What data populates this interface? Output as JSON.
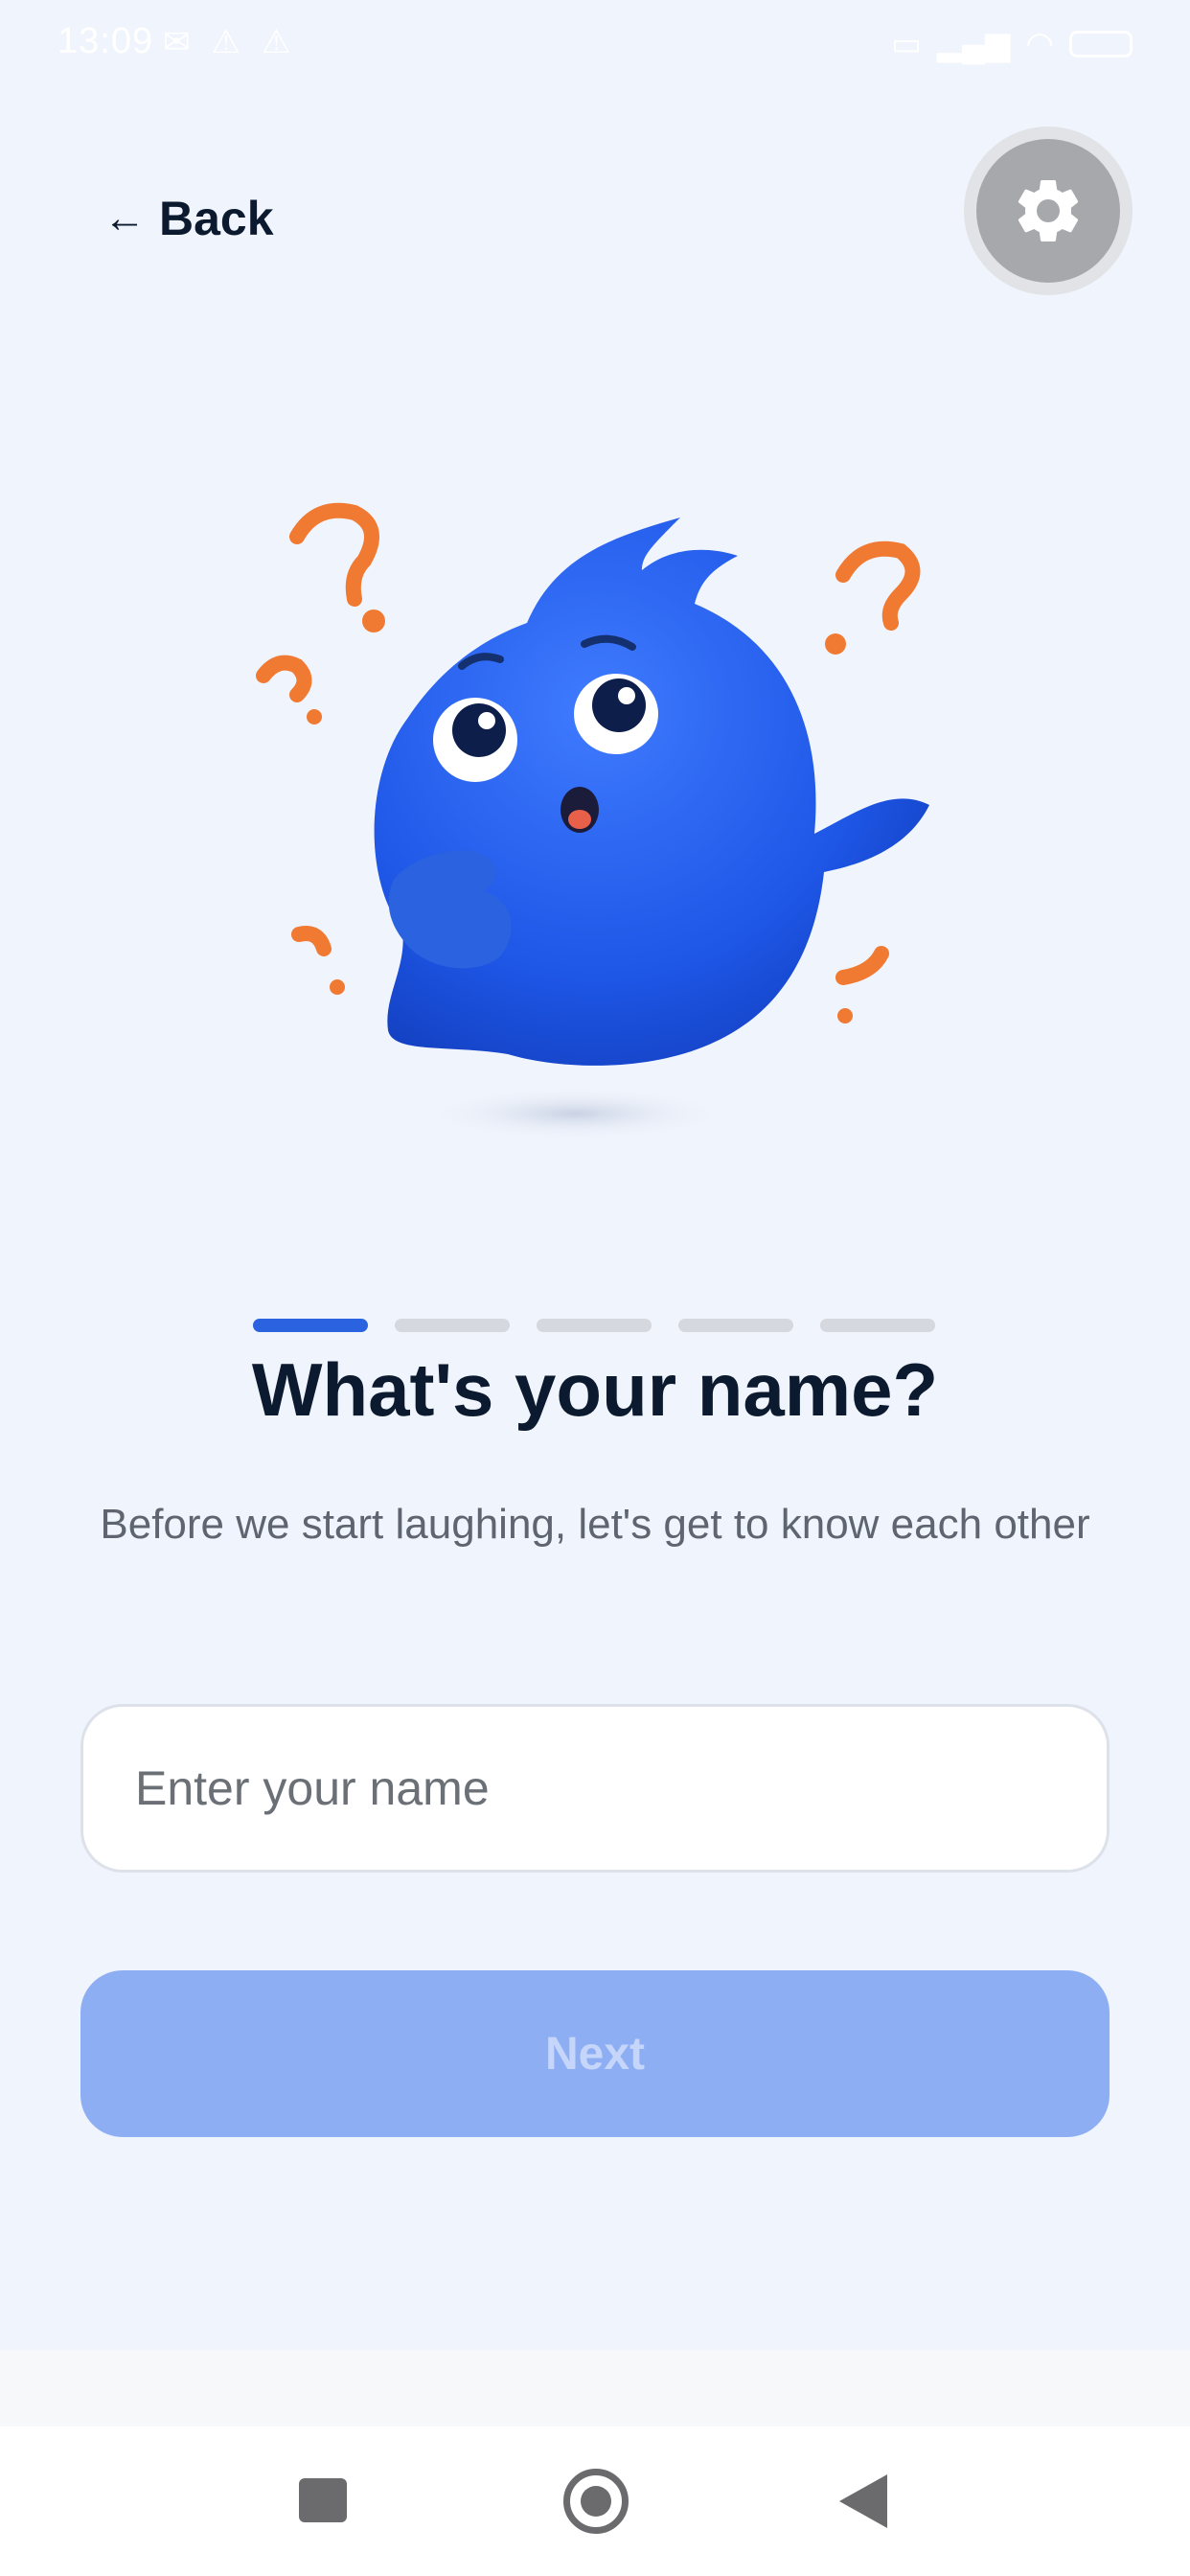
{
  "status_bar": {
    "time": "13:09",
    "left_icons": [
      "notification-icon",
      "alert-icon",
      "alert-icon"
    ],
    "right_icons": [
      "sim-icon",
      "signal-icon",
      "wifi-icon",
      "battery-icon"
    ]
  },
  "header": {
    "back_arrow": "←",
    "back_label": "Back",
    "settings_icon": "gear-icon"
  },
  "mascot": {
    "icon": "confused-blue-mascot-illustration",
    "colors": {
      "body": "#2a62e0",
      "question_marks": "#f07a32"
    }
  },
  "progress": {
    "total_steps": 5,
    "current_step": 1
  },
  "main": {
    "title": "What's your name?",
    "subtitle": "Before we start laughing, let's get to know each other",
    "name_input": {
      "placeholder": "Enter your name",
      "value": ""
    },
    "next_label": "Next"
  },
  "colors": {
    "background": "#f0f4fc",
    "accent": "#2a62e0",
    "button_disabled": "#8eaef4",
    "title": "#0b1a2e"
  },
  "nav_bar": {
    "buttons": [
      "recents-button",
      "home-button",
      "back-button"
    ]
  }
}
